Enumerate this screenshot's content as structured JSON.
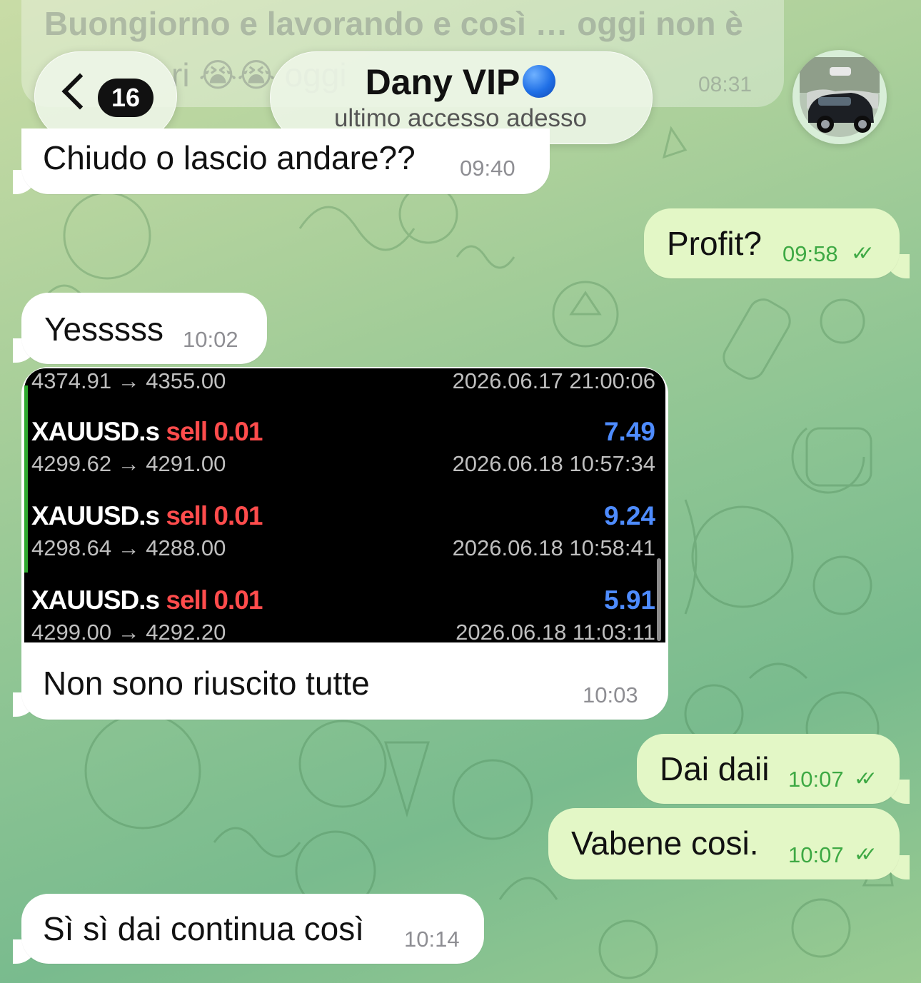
{
  "header": {
    "prev_message": {
      "line1": "Buongiorno e lavorando e così … oggi non è",
      "line2": "ri 😭😭 oggi",
      "time": "08:31"
    },
    "back_badge": "16",
    "contact_name": "Dany VIP",
    "status": "ultimo accesso adesso"
  },
  "messages": [
    {
      "dir": "in",
      "text": "Chiudo o lascio andare??",
      "time": "09:40"
    },
    {
      "dir": "out",
      "text": "Profit?",
      "time": "09:58"
    },
    {
      "dir": "in",
      "text": "Yesssss",
      "time": "10:02"
    },
    {
      "dir": "in",
      "text": "Non sono riuscito tutte",
      "time": "10:03"
    },
    {
      "dir": "out",
      "text": "Dai daii",
      "time": "10:07"
    },
    {
      "dir": "out",
      "text": "Vabene cosi.",
      "time": "10:07"
    },
    {
      "dir": "in",
      "text": "Sì sì dai continua così",
      "time": "10:14"
    }
  ],
  "trades": {
    "partial": {
      "prices": "4374.91 → 4355.00",
      "time": "2026.06.17 21:00:06"
    },
    "rows": [
      {
        "symbol": "XAUUSD.s",
        "side": "sell",
        "volume": "0.01",
        "profit": "7.49",
        "prices": "4299.62 → 4291.00",
        "time": "2026.06.18 10:57:34"
      },
      {
        "symbol": "XAUUSD.s",
        "side": "sell",
        "volume": "0.01",
        "profit": "9.24",
        "prices": "4298.64 → 4288.00",
        "time": "2026.06.18 10:58:41"
      },
      {
        "symbol": "XAUUSD.s",
        "side": "sell",
        "volume": "0.01",
        "profit": "5.91",
        "prices": "4299.00 → 4292.20",
        "time": "2026.06.18 11:03:11"
      }
    ]
  },
  "icons": {
    "back": "chevron-left-icon",
    "read_receipt": "double-check-icon",
    "verified": "blue-circle-emoji",
    "avatar": "car-photo-avatar"
  },
  "colors": {
    "outgoing_bubble": "#e3f7c6",
    "incoming_bubble": "#ffffff",
    "read_tick": "#3ea944",
    "sell": "#ff4c4c",
    "profit": "#4e8cff"
  }
}
